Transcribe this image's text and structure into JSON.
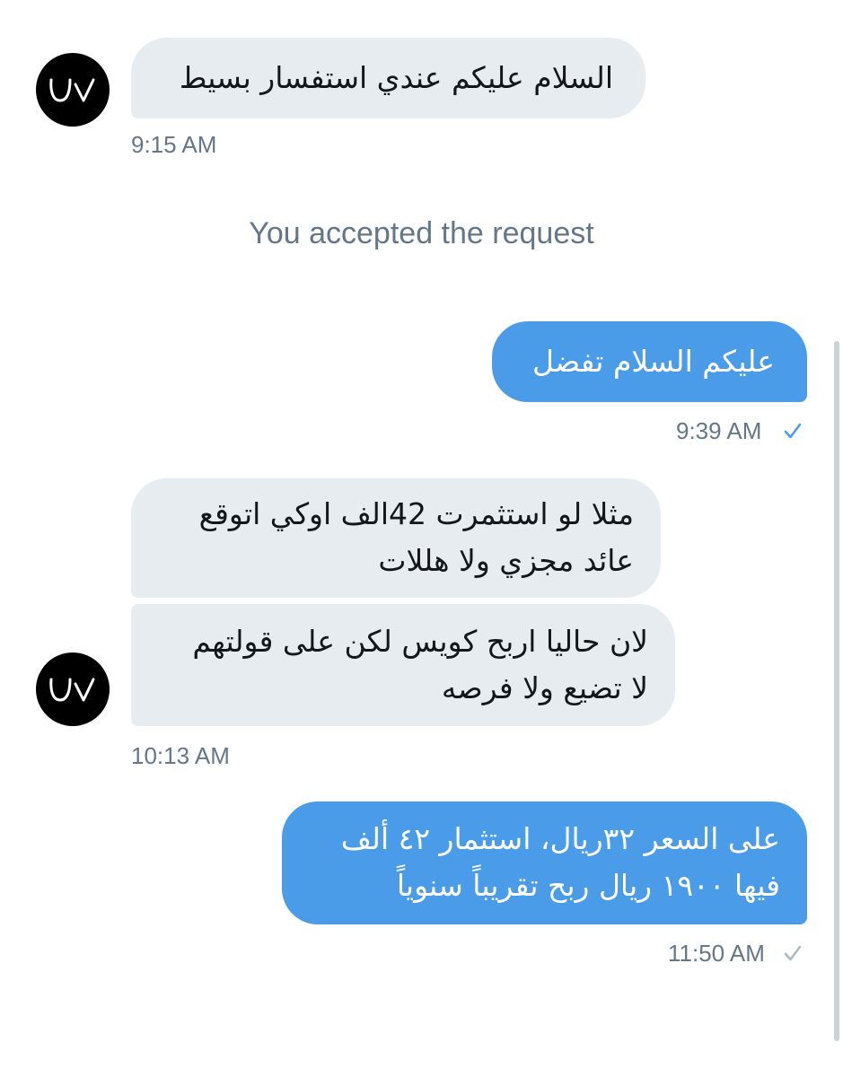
{
  "conversation": {
    "avatar_initials": "Uv",
    "messages": [
      {
        "direction": "incoming",
        "lines": [
          "السلام عليكم عندي استفسار بسيط"
        ],
        "time": "9:15 AM"
      },
      {
        "direction": "system",
        "text": "You accepted the request"
      },
      {
        "direction": "outgoing",
        "lines": [
          "عليكم السلام تفضل"
        ],
        "time": "9:39 AM",
        "status": "sent-check-icon"
      },
      {
        "direction": "incoming",
        "lines": [
          "مثلا لو استثمرت 42الف اوكي اتوقع",
          "عائد مجزي ولا هللات"
        ]
      },
      {
        "direction": "incoming",
        "lines": [
          "لان حاليا اربح كويس لكن على قولتهم",
          "لا تضيع ولا فرصه"
        ],
        "time": "10:13 AM"
      },
      {
        "direction": "outgoing",
        "lines": [
          "على السعر ٣٢ريال، استثمار ٤٢ ألف",
          "فيها ١٩٠٠ ريال ربح تقريباً سنوياً"
        ],
        "time": "11:50 AM",
        "status": "sent-check-icon"
      }
    ]
  },
  "colors": {
    "incoming_bubble": "#e6ecf0",
    "outgoing_bubble": "#4a9be8",
    "timestamp": "#657786",
    "check_blue": "#4a9be8",
    "check_grey": "#aab8c2"
  }
}
